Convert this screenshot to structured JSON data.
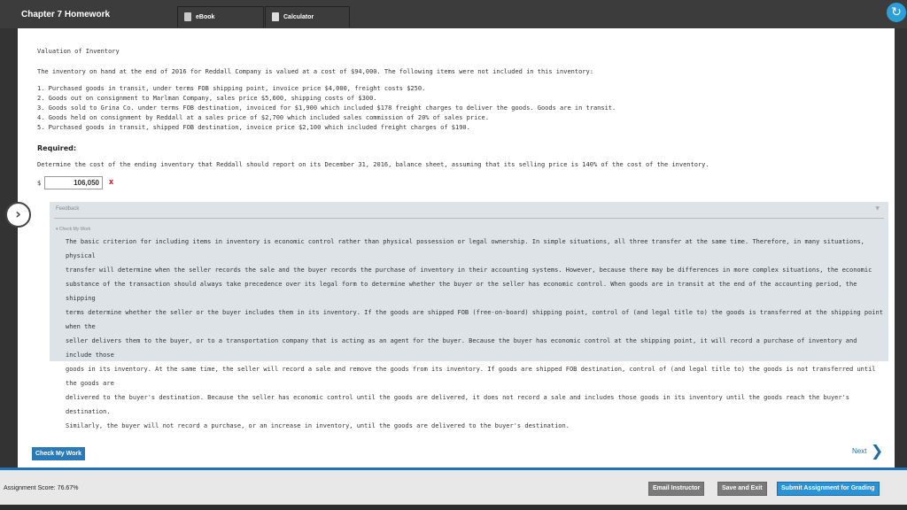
{
  "header": {
    "title": "Chapter 7 Homework",
    "tabs": [
      {
        "label": "eBook",
        "icon": "book-icon"
      },
      {
        "label": "Calculator",
        "icon": "calculator-icon"
      }
    ],
    "refresh_icon": "refresh-icon"
  },
  "question": {
    "title": "Valuation of Inventory",
    "intro": "The inventory on hand at the end of 2016 for Reddall Company is valued at a cost of $94,000. The following items were not included in this inventory:",
    "items": [
      "1. Purchased goods in transit, under terms FOB shipping point, invoice price $4,000, freight costs $250.",
      "2. Goods out on consignment to Marlman Company, sales price $5,600, shipping costs of $300.",
      "3. Goods sold to Grina Co. under terms FOB destination, invoiced for $1,900 which included $178 freight charges to deliver the goods. Goods are in transit.",
      "4. Goods held on consignment by Reddall at a sales price of $2,700 which included sales commission of 20% of sales price.",
      "5. Purchased goods in transit, shipped FOB destination, invoice price $2,100 which included freight charges of $190."
    ],
    "required_label": "Required:",
    "prompt": "Determine the cost of the ending inventory that Reddall should report on its December 31, 2016, balance sheet, assuming that its selling price is 140% of the cost of the inventory.",
    "currency": "$",
    "answer_value": "106,050",
    "incorrect_mark": "x"
  },
  "feedback": {
    "heading": "Feedback",
    "section_label": "▾ Check My Work",
    "lines": [
      "The basic criterion for including items in inventory is economic control rather than physical possession or legal ownership. In simple situations, all three transfer at the same time. Therefore, in many situations, physical",
      "transfer will determine when the seller records the sale and the buyer records the purchase of inventory in their accounting systems. However, because there may be differences in more complex situations, the economic",
      "substance of the transaction should always take precedence over its legal form to determine whether the buyer or the seller has economic control. When goods are in transit at the end of the accounting period, the shipping",
      "terms determine whether the seller or the buyer includes them in its inventory. If the goods are shipped FOB (free-on-board) shipping point, control of (and legal title to) the goods is transferred at the shipping point when the",
      "seller delivers them to the buyer, or to a transportation company that is acting as an agent for the buyer. Because the buyer has economic control at the shipping point, it will record a purchase of inventory and include those",
      "goods in its inventory. At the same time, the seller will record a sale and remove the goods from its inventory. If goods are shipped FOB destination, control of (and legal title to) the goods is not transferred until the goods are",
      "delivered to the buyer's destination. Because the seller has economic control until the goods are delivered, it does not record a sale and includes those goods in its inventory until the goods reach the buyer's destination.",
      "Similarly, the buyer will not record a purchase, or an increase in inventory, until the goods are delivered to the buyer's destination."
    ]
  },
  "footer": {
    "check_button": "Check My Work",
    "next_label": "Next",
    "score": "Assignment Score: 76.67%",
    "email_button": "Email Instructor",
    "save_button": "Save and Exit",
    "submit_button": "Submit Assignment for Grading"
  },
  "colors": {
    "accent": "#2a92d6",
    "error": "#d0021b",
    "feedback_bg": "#dde3e6"
  }
}
